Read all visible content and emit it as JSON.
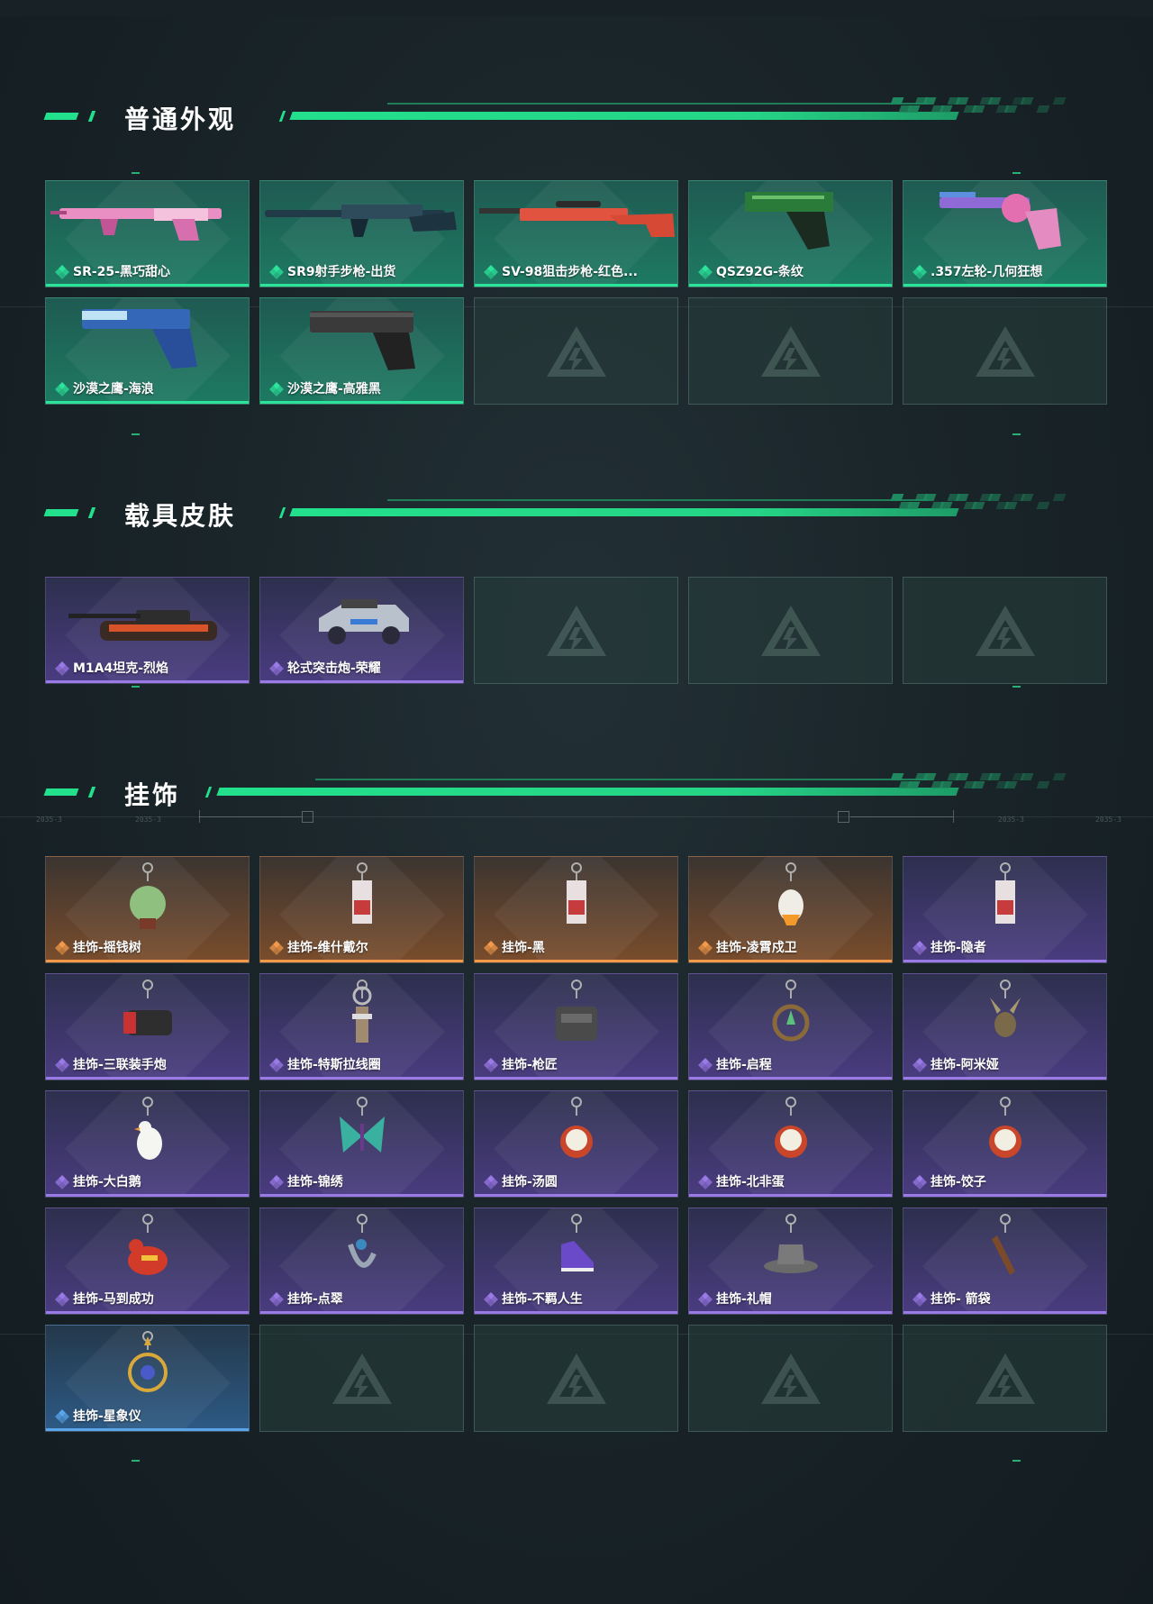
{
  "sections": [
    {
      "title": "普通外观",
      "items": [
        {
          "label": "SR-25-黑巧甜心",
          "rarity": "green",
          "icon": "rifle-pink-icon"
        },
        {
          "label": "SR9射手步枪-出货",
          "rarity": "green",
          "icon": "rifle-dark-icon"
        },
        {
          "label": "SV-98狙击步枪-红色...",
          "rarity": "green",
          "icon": "sniper-red-icon"
        },
        {
          "label": "QSZ92G-条纹",
          "rarity": "green",
          "icon": "pistol-green-icon"
        },
        {
          "label": ".357左轮-几何狂想",
          "rarity": "green",
          "icon": "revolver-pink-icon"
        },
        {
          "label": "沙漠之鹰-海浪",
          "rarity": "green",
          "icon": "pistol-blue-icon"
        },
        {
          "label": "沙漠之鹰-高雅黑",
          "rarity": "green",
          "icon": "pistol-black-icon"
        },
        {
          "label": "",
          "rarity": "empty",
          "icon": "empty-slot-logo-icon"
        },
        {
          "label": "",
          "rarity": "empty",
          "icon": "empty-slot-logo-icon"
        },
        {
          "label": "",
          "rarity": "empty",
          "icon": "empty-slot-logo-icon"
        }
      ]
    },
    {
      "title": "载具皮肤",
      "items": [
        {
          "label": "M1A4坦克-烈焰",
          "rarity": "purple",
          "icon": "tank-icon"
        },
        {
          "label": "轮式突击炮-荣耀",
          "rarity": "purple",
          "icon": "armored-vehicle-icon"
        },
        {
          "label": "",
          "rarity": "empty",
          "icon": "empty-slot-logo-icon"
        },
        {
          "label": "",
          "rarity": "empty",
          "icon": "empty-slot-logo-icon"
        },
        {
          "label": "",
          "rarity": "empty",
          "icon": "empty-slot-logo-icon"
        }
      ]
    },
    {
      "title": "挂饰",
      "items": [
        {
          "label": "挂饰-摇钱树",
          "rarity": "orange",
          "icon": "charm-money-tree-icon"
        },
        {
          "label": "挂饰-维什戴尔",
          "rarity": "orange",
          "icon": "charm-card-icon"
        },
        {
          "label": "挂饰-黑",
          "rarity": "orange",
          "icon": "charm-card-icon"
        },
        {
          "label": "挂饰-凌霄戍卫",
          "rarity": "orange",
          "icon": "charm-bird-icon"
        },
        {
          "label": "挂饰-隐者",
          "rarity": "purple",
          "icon": "charm-card-icon"
        },
        {
          "label": "挂饰-三联装手炮",
          "rarity": "purple",
          "icon": "charm-cannon-icon"
        },
        {
          "label": "挂饰-特斯拉线圈",
          "rarity": "purple",
          "icon": "charm-coil-icon"
        },
        {
          "label": "挂饰-枪匠",
          "rarity": "purple",
          "icon": "charm-vest-icon"
        },
        {
          "label": "挂饰-启程",
          "rarity": "purple",
          "icon": "charm-ring-icon"
        },
        {
          "label": "挂饰-阿米娅",
          "rarity": "purple",
          "icon": "charm-rabbit-icon"
        },
        {
          "label": "挂饰-大白鹅",
          "rarity": "purple",
          "icon": "charm-goose-icon"
        },
        {
          "label": "挂饰-锦绣",
          "rarity": "purple",
          "icon": "charm-butterfly-icon"
        },
        {
          "label": "挂饰-汤圆",
          "rarity": "purple",
          "icon": "charm-bowl-icon"
        },
        {
          "label": "挂饰-北非蛋",
          "rarity": "purple",
          "icon": "charm-bowl-icon"
        },
        {
          "label": "挂饰-饺子",
          "rarity": "purple",
          "icon": "charm-bowl-icon"
        },
        {
          "label": "挂饰-马到成功",
          "rarity": "purple",
          "icon": "charm-horse-icon"
        },
        {
          "label": "挂饰-点翠",
          "rarity": "purple",
          "icon": "charm-hairpin-icon"
        },
        {
          "label": "挂饰-不羁人生",
          "rarity": "purple",
          "icon": "charm-shoe-icon"
        },
        {
          "label": "挂饰-礼帽",
          "rarity": "purple",
          "icon": "charm-hat-icon"
        },
        {
          "label": "挂饰- 箭袋",
          "rarity": "purple",
          "icon": "charm-quiver-icon"
        },
        {
          "label": "挂饰-星象仪",
          "rarity": "blue",
          "icon": "charm-astrolabe-icon"
        },
        {
          "label": "",
          "rarity": "empty",
          "icon": "empty-slot-logo-icon"
        },
        {
          "label": "",
          "rarity": "empty",
          "icon": "empty-slot-logo-icon"
        },
        {
          "label": "",
          "rarity": "empty",
          "icon": "empty-slot-logo-icon"
        },
        {
          "label": "",
          "rarity": "empty",
          "icon": "empty-slot-logo-icon"
        }
      ]
    }
  ],
  "background": {
    "tick_labels": [
      "2035-3",
      "2035-3",
      "2035-3",
      "2035-3"
    ]
  },
  "colors": {
    "accent": "#22e08c",
    "green": "#2ce39a",
    "purple": "#9a7ae6",
    "orange": "#f29a4a",
    "blue": "#5aa6ea"
  }
}
